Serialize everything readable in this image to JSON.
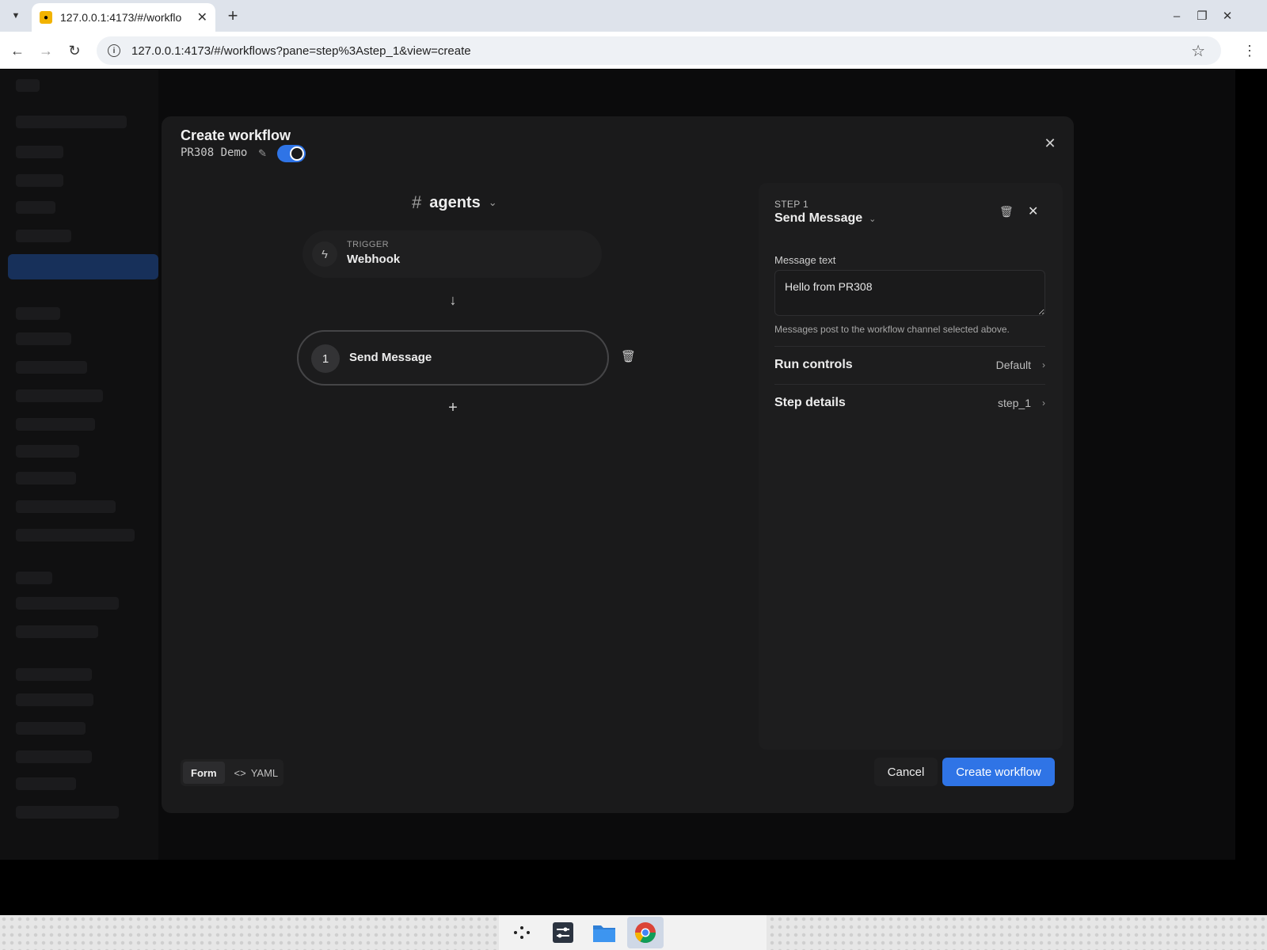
{
  "browser": {
    "tab_title": "127.0.0.1:4173/#/workflo",
    "url": "127.0.0.1:4173/#/workflows?pane=step%3Astep_1&view=create"
  },
  "modal": {
    "title": "Create workflow",
    "workflow_name": "PR308 Demo",
    "enabled": true,
    "channel": "agents",
    "trigger": {
      "label": "TRIGGER",
      "value": "Webhook"
    },
    "steps": [
      {
        "number": "1",
        "label": "Send Message"
      }
    ],
    "panel": {
      "kicker": "STEP 1",
      "step_type": "Send Message",
      "message_label": "Message text",
      "message_value": "Hello from PR308",
      "hint": "Messages post to the workflow channel selected above.",
      "run_controls": {
        "label": "Run controls",
        "value": "Default"
      },
      "step_details": {
        "label": "Step details",
        "value": "step_1"
      }
    },
    "footer": {
      "mode_form": "Form",
      "mode_yaml": "YAML",
      "cancel": "Cancel",
      "create": "Create workflow"
    }
  },
  "colors": {
    "accent": "#2f74e6",
    "modal_bg": "#1a1a1b"
  }
}
